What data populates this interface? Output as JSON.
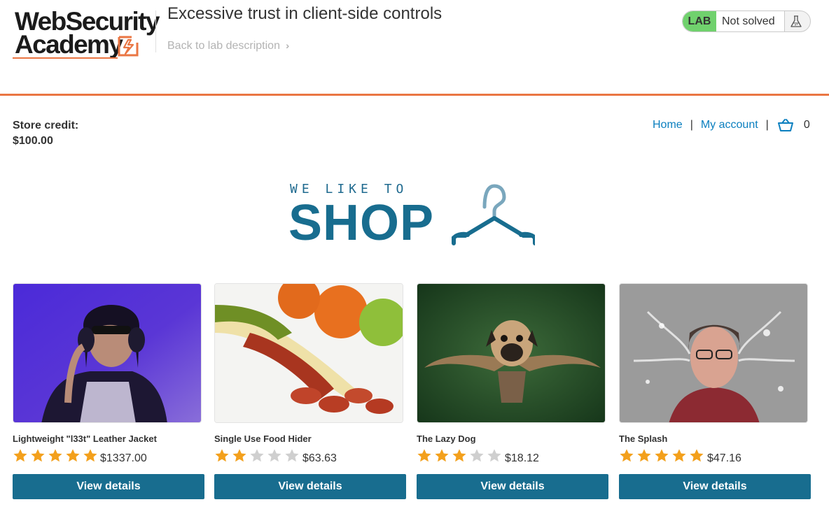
{
  "header": {
    "logo_line1": "WebSecurity",
    "logo_line2": "Academy",
    "lab_title": "Excessive trust in client-side controls",
    "back_link": "Back to lab description",
    "lab_tag": "LAB",
    "status": "Not solved"
  },
  "store": {
    "credit_label": "Store credit:",
    "credit_value": "$100.00"
  },
  "nav": {
    "home": "Home",
    "separator": "|",
    "my_account": "My account",
    "cart_count": "0"
  },
  "banner": {
    "small_text": "WE LIKE TO",
    "big_text": "SHOP"
  },
  "products": [
    {
      "name": "Lightweight \"l33t\" Leather Jacket",
      "rating": 5,
      "price": "$1337.00",
      "button": "View details",
      "image": "woman-with-headphones-photo"
    },
    {
      "name": "Single Use Food Hider",
      "rating": 2,
      "price": "$63.63",
      "button": "View details",
      "image": "banana-with-sausage-photo"
    },
    {
      "name": "The Lazy Dog",
      "rating": 3,
      "price": "$18.12",
      "button": "View details",
      "image": "flying-pug-photo"
    },
    {
      "name": "The Splash",
      "rating": 5,
      "price": "$47.16",
      "button": "View details",
      "image": "water-splash-face-photo"
    }
  ],
  "colors": {
    "accent_orange": "#ea7643",
    "primary_blue": "#186d8f",
    "link_blue": "#0a7fbf",
    "lab_green": "#70d16d",
    "star_gold": "#f3a01c",
    "star_grey": "#cfcfcf"
  }
}
